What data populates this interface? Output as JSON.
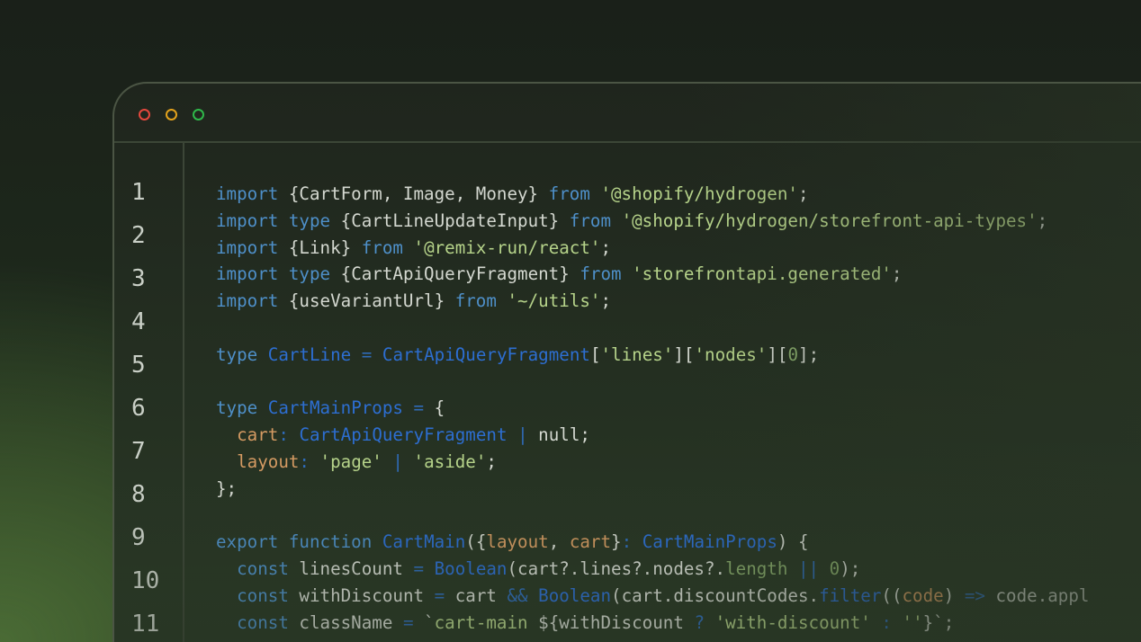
{
  "window": {
    "traffic_lights": {
      "close": {
        "icon": "close-dot-icon",
        "color": "#e5483d"
      },
      "minimize": {
        "icon": "minimize-dot-icon",
        "color": "#e3a21c"
      },
      "zoom": {
        "icon": "zoom-dot-icon",
        "color": "#2fb84a"
      }
    }
  },
  "colors": {
    "keyword": "#4e8fc8",
    "type_name": "#2d6ed1",
    "string": "#b6d38a",
    "property": "#d49a62",
    "identifier": "#d4d8d0",
    "line_number": "#c9cfc6"
  },
  "line_numbers": [
    "1",
    "2",
    "3",
    "4",
    "5",
    "6",
    "7",
    "8",
    "9",
    "10",
    "11"
  ],
  "code_lines": [
    [
      [
        "kw",
        "import"
      ],
      [
        "pun",
        " {CartForm, Image, Money} "
      ],
      [
        "kw",
        "from"
      ],
      [
        "pun",
        " "
      ],
      [
        "str",
        "'@shopify/hydrogen'"
      ],
      [
        "pun",
        ";"
      ]
    ],
    [
      [
        "kw",
        "import"
      ],
      [
        "pun",
        " "
      ],
      [
        "kw",
        "type"
      ],
      [
        "pun",
        " {CartLineUpdateInput} "
      ],
      [
        "kw",
        "from"
      ],
      [
        "pun",
        " "
      ],
      [
        "str",
        "'@shopify/hydrogen/storefront-api-types'"
      ],
      [
        "pun",
        ";"
      ]
    ],
    [
      [
        "kw",
        "import"
      ],
      [
        "pun",
        " {Link} "
      ],
      [
        "kw",
        "from"
      ],
      [
        "pun",
        " "
      ],
      [
        "str",
        "'@remix-run/react'"
      ],
      [
        "pun",
        ";"
      ]
    ],
    [
      [
        "kw",
        "import"
      ],
      [
        "pun",
        " "
      ],
      [
        "kw",
        "type"
      ],
      [
        "pun",
        " {CartApiQueryFragment} "
      ],
      [
        "kw",
        "from"
      ],
      [
        "pun",
        " "
      ],
      [
        "str",
        "'storefrontapi.generated'"
      ],
      [
        "pun",
        ";"
      ]
    ],
    [
      [
        "kw",
        "import"
      ],
      [
        "pun",
        " {useVariantUrl} "
      ],
      [
        "kw",
        "from"
      ],
      [
        "pun",
        " "
      ],
      [
        "str",
        "'~/utils'"
      ],
      [
        "pun",
        ";"
      ]
    ],
    [],
    [
      [
        "kw",
        "type"
      ],
      [
        "pun",
        " "
      ],
      [
        "type",
        "CartLine"
      ],
      [
        "pun",
        " "
      ],
      [
        "op",
        "="
      ],
      [
        "pun",
        " "
      ],
      [
        "type",
        "CartApiQueryFragment"
      ],
      [
        "pun",
        "["
      ],
      [
        "str",
        "'lines'"
      ],
      [
        "pun",
        "]["
      ],
      [
        "str",
        "'nodes'"
      ],
      [
        "pun",
        "]["
      ],
      [
        "num",
        "0"
      ],
      [
        "pun",
        "];"
      ]
    ],
    [],
    [
      [
        "kw",
        "type"
      ],
      [
        "pun",
        " "
      ],
      [
        "type",
        "CartMainProps"
      ],
      [
        "pun",
        " "
      ],
      [
        "op",
        "="
      ],
      [
        "pun",
        " {"
      ]
    ],
    [
      [
        "pun",
        "  "
      ],
      [
        "prop",
        "cart"
      ],
      [
        "op",
        ":"
      ],
      [
        "pun",
        " "
      ],
      [
        "type",
        "CartApiQueryFragment"
      ],
      [
        "pun",
        " "
      ],
      [
        "op",
        "|"
      ],
      [
        "pun",
        " null;"
      ]
    ],
    [
      [
        "pun",
        "  "
      ],
      [
        "prop",
        "layout"
      ],
      [
        "op",
        ":"
      ],
      [
        "pun",
        " "
      ],
      [
        "str",
        "'page'"
      ],
      [
        "pun",
        " "
      ],
      [
        "op",
        "|"
      ],
      [
        "pun",
        " "
      ],
      [
        "str",
        "'aside'"
      ],
      [
        "pun",
        ";"
      ]
    ],
    [
      [
        "pun",
        "};"
      ]
    ],
    [],
    [
      [
        "kw",
        "export"
      ],
      [
        "pun",
        " "
      ],
      [
        "kw",
        "function"
      ],
      [
        "pun",
        " "
      ],
      [
        "type",
        "CartMain"
      ],
      [
        "pun",
        "({"
      ],
      [
        "prop",
        "layout"
      ],
      [
        "pun",
        ", "
      ],
      [
        "prop",
        "cart"
      ],
      [
        "pun",
        "}"
      ],
      [
        "op",
        ":"
      ],
      [
        "pun",
        " "
      ],
      [
        "type",
        "CartMainProps"
      ],
      [
        "pun",
        ") {"
      ]
    ],
    [
      [
        "pun",
        "  "
      ],
      [
        "kw",
        "const"
      ],
      [
        "pun",
        " linesCount "
      ],
      [
        "op",
        "="
      ],
      [
        "pun",
        " "
      ],
      [
        "type",
        "Boolean"
      ],
      [
        "pun",
        "(cart?.lines?.nodes?."
      ],
      [
        "num",
        "length"
      ],
      [
        "pun",
        " "
      ],
      [
        "op",
        "||"
      ],
      [
        "pun",
        " "
      ],
      [
        "num",
        "0"
      ],
      [
        "pun",
        ");"
      ]
    ],
    [
      [
        "pun",
        "  "
      ],
      [
        "kw",
        "const"
      ],
      [
        "pun",
        " withDiscount "
      ],
      [
        "op",
        "="
      ],
      [
        "pun",
        " cart "
      ],
      [
        "op",
        "&&"
      ],
      [
        "pun",
        " "
      ],
      [
        "type",
        "Boolean"
      ],
      [
        "pun",
        "(cart.discountCodes."
      ],
      [
        "type",
        "filter"
      ],
      [
        "pun",
        "(("
      ],
      [
        "prop",
        "code"
      ],
      [
        "pun",
        ") "
      ],
      [
        "op",
        "=>"
      ],
      [
        "pun",
        " code.appl"
      ]
    ],
    [
      [
        "pun",
        "  "
      ],
      [
        "kw",
        "const"
      ],
      [
        "pun",
        " className "
      ],
      [
        "op",
        "="
      ],
      [
        "pun",
        " `"
      ],
      [
        "str",
        "cart-main "
      ],
      [
        "pun",
        "${withDiscount "
      ],
      [
        "op",
        "?"
      ],
      [
        "pun",
        " "
      ],
      [
        "str",
        "'with-discount'"
      ],
      [
        "pun",
        " "
      ],
      [
        "op",
        ":"
      ],
      [
        "pun",
        " "
      ],
      [
        "str",
        "''"
      ],
      [
        "pun",
        "}`;"
      ]
    ]
  ]
}
